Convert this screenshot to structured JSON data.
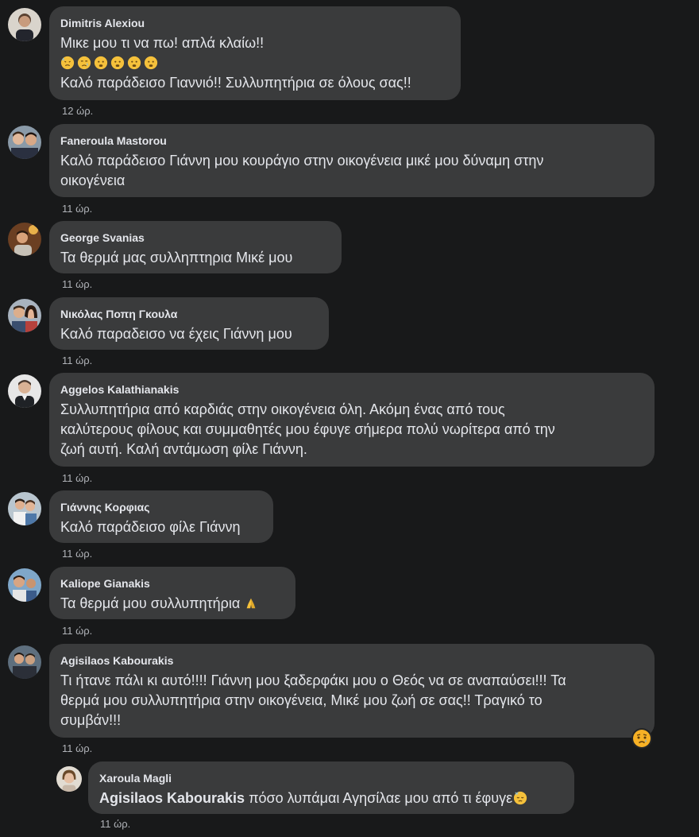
{
  "comments": [
    {
      "author": "Dimitris Alexiou",
      "lines": [
        "Μικε μου τι να πω! απλά κλαίω!!",
        "Καλό παράδεισο Γιαννιό!! Συλλυπητήρια σε όλους σας!!"
      ],
      "emojis": [
        "downcast-sweat-face-icon",
        "crying-face-icon",
        "anguished-face-icon",
        "anguished-face-icon",
        "anguished-face-icon",
        "anguished-face-icon"
      ],
      "time": "12 ώρ."
    },
    {
      "author": "Faneroula Mastorou",
      "lines": [
        "Καλό παράδεισο Γιάννη μου κουράγιο στην οικογένεια μικέ μου δύναμη στην",
        "οικογένεια"
      ],
      "time": "11 ώρ."
    },
    {
      "author": "George Svanias",
      "lines": [
        "Τα θερμά μας συλληπτηρια Μικέ μου"
      ],
      "time": "11 ώρ."
    },
    {
      "author": "Νικόλας Ποπη Γκουλα",
      "lines": [
        "Καλό παραδεισο να έχεις Γιάννη μου"
      ],
      "time": "11 ώρ."
    },
    {
      "author": "Aggelos Kalathianakis",
      "lines": [
        "Συλλυπητήρια από καρδιάς στην οικογένεια όλη. Ακόμη ένας από τους",
        "καλύτερους φίλους και συμμαθητές μου έφυγε σήμερα πολύ νωρίτερα από την",
        "ζωή αυτή. Καλή αντάμωση φίλε Γιάννη."
      ],
      "time": "11 ώρ."
    },
    {
      "author": "Γιάννης Κορφιας",
      "lines": [
        "Καλό παράδεισο φίλε Γιάννη"
      ],
      "time": "11 ώρ."
    },
    {
      "author": "Kaliope Gianakis",
      "lines": [
        "Τα θερμά μου συλλυπητήρια"
      ],
      "trailing_emoji": "folded-hands-icon",
      "time": "11 ώρ."
    },
    {
      "author": "Agisilaos Kabourakis",
      "lines": [
        "Τι ήτανε πάλι κι αυτό!!!! Γιάννη μου ξαδερφάκι μου ο Θεός να σε αναπαύσει!!! Τα",
        "θερμά μου συλλυπητήρια στην οικογένεια, Μικέ μου ζωή σε σας!! Τραγικό το",
        "συμβάν!!!"
      ],
      "reaction": "sad-reaction-icon",
      "time": "11 ώρ."
    }
  ],
  "reply": {
    "author": "Xaroula Magli",
    "mention": "Agisilaos Kabourakis",
    "text": "πόσο λυπάμαι Αγησίλαε μου από τι έφυγε",
    "trailing_emoji": "sad-relieved-face-icon",
    "time": "11 ώρ."
  },
  "colors": {
    "background": "#18191a",
    "bubble": "#3a3b3c",
    "text": "#e4e6eb",
    "secondary_text": "#b0b3b8"
  }
}
